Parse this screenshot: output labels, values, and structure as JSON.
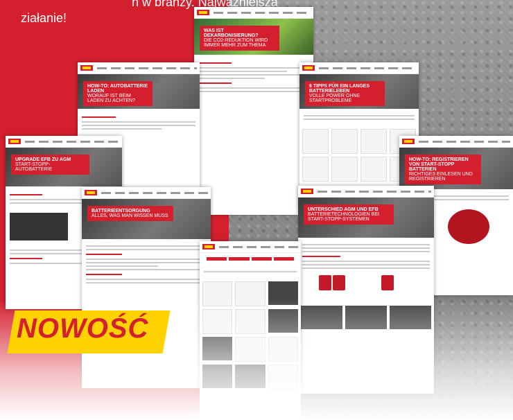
{
  "headline_text": "n w branży. Najważniejsza",
  "headline_text2": "ziałanie!",
  "badge": "NOWOŚĆ",
  "pages": [
    {
      "title": "WAS IST DEKARBONISIERUNG?",
      "sub": "DIE CO2-REDUKTION WIRD IMMER MEHR ZUM THEMA"
    },
    {
      "title": "HOW-TO: AUTOBATTERIE LADEN",
      "sub": "WORAUF IST BEIM LADEN ZU ACHTEN?"
    },
    {
      "title": "6 TIPPS FÜR EIN LANGES BATTERIELEBEN",
      "sub": "VOLLE POWER OHNE STARTPROBLEME"
    },
    {
      "title": "UPGRADE EFB ZU AGM",
      "sub": "START-STOPP-AUTOBATTERIE"
    },
    {
      "title": "BATTERIEENTSORGUNG",
      "sub": "ALLES, WAS MAN WISSEN MUSS"
    },
    {
      "title": "HOW-TO: REGISTRIEREN VON START-STOPP BATTERIEN",
      "sub": "RICHTIGES EINLESEN UND REGISTRIEREN"
    },
    {
      "title": "UNTERSCHIED AGM UND EFB",
      "sub": "BATTERIETECHNOLOGIEN BEI START-STOPP-SYSTEMEN"
    }
  ]
}
